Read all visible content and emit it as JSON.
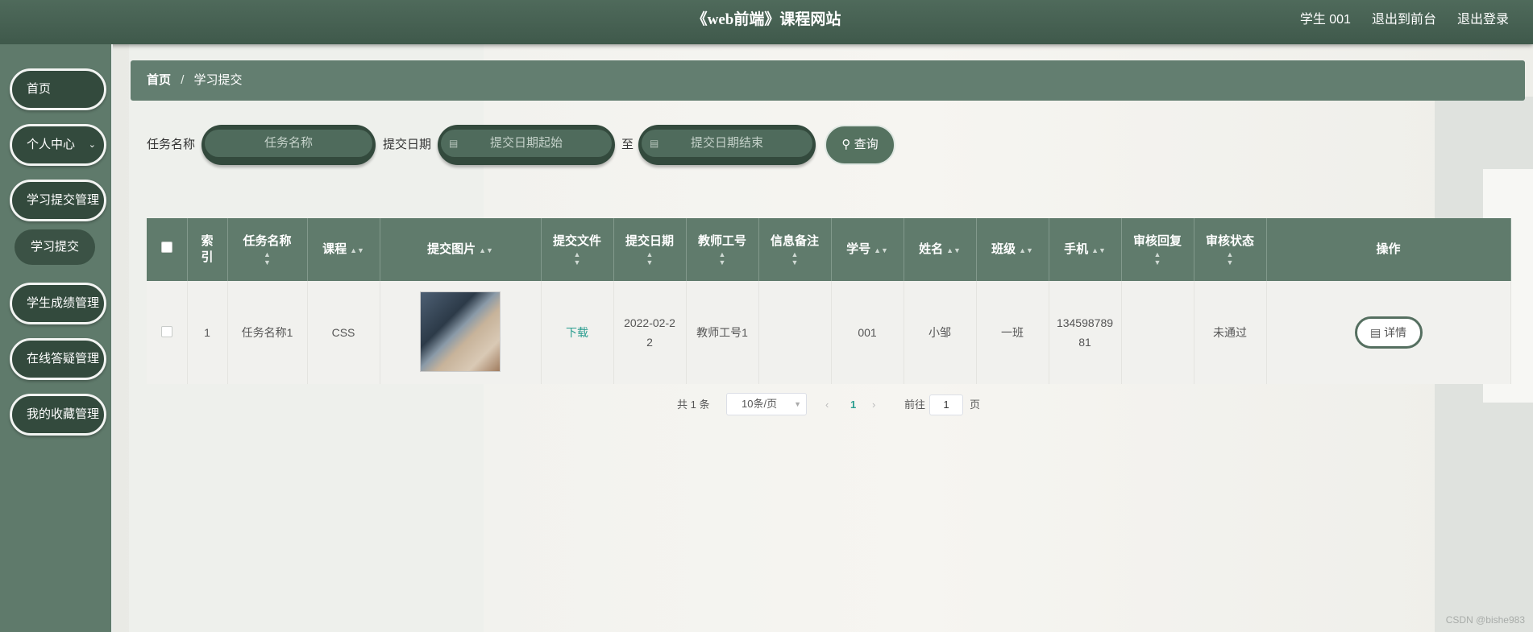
{
  "header": {
    "title": "《web前端》课程网站",
    "user": "学生  001",
    "back_front": "退出到前台",
    "logout": "退出登录"
  },
  "sidebar": {
    "items": [
      {
        "label": "首页"
      },
      {
        "label": "个人中心"
      },
      {
        "label": "学习提交管理"
      },
      {
        "label": "学生成绩管理"
      },
      {
        "label": "在线答疑管理"
      },
      {
        "label": "我的收藏管理"
      }
    ],
    "sub_item": "学习提交"
  },
  "breadcrumb": {
    "home": "首页",
    "sep": "/",
    "current": "学习提交"
  },
  "search": {
    "task_label": "任务名称",
    "task_placeholder": "任务名称",
    "date_label": "提交日期",
    "date_start_placeholder": "提交日期起始",
    "to_label": "至",
    "date_end_placeholder": "提交日期结束",
    "query_label": "查询"
  },
  "table": {
    "headers": {
      "index": "索引",
      "task": "任务名称",
      "course": "课程",
      "image": "提交图片",
      "file": "提交文件",
      "date": "提交日期",
      "teacher": "教师工号",
      "note": "信息备注",
      "sid": "学号",
      "name": "姓名",
      "cls": "班级",
      "phone": "手机",
      "reply": "审核回复",
      "status": "审核状态",
      "op": "操作"
    },
    "rows": [
      {
        "index": "1",
        "task": "任务名称1",
        "course": "CSS",
        "file": "下载",
        "date_l1": "2022-02-2",
        "date_l2": "2",
        "teacher": "教师工号1",
        "note": "",
        "sid": "001",
        "name": "小邹",
        "cls": "一班",
        "phone_l1": "134598789",
        "phone_l2": "81",
        "reply": "",
        "status": "未通过",
        "op": "详情"
      }
    ]
  },
  "pagination": {
    "total_prefix": "共",
    "total": "1",
    "total_suffix": "条",
    "page_size": "10条/页",
    "current": "1",
    "goto_prefix": "前往",
    "goto_value": "1",
    "goto_suffix": "页"
  },
  "watermark": "CSDN @bishe983"
}
